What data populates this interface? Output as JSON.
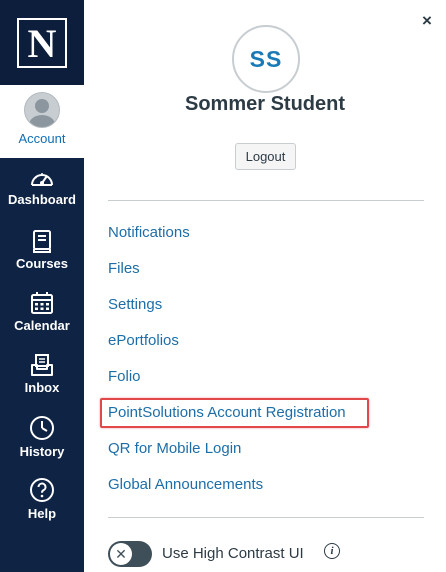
{
  "brand": {
    "logo_letter": "N",
    "nav_bg": "#0f2344",
    "link_color": "#1d6ea8"
  },
  "global_nav": {
    "account_label": "Account",
    "items": [
      {
        "label": "Dashboard",
        "icon": "dashboard-icon"
      },
      {
        "label": "Courses",
        "icon": "courses-icon"
      },
      {
        "label": "Calendar",
        "icon": "calendar-icon"
      },
      {
        "label": "Inbox",
        "icon": "inbox-icon"
      },
      {
        "label": "History",
        "icon": "history-icon"
      },
      {
        "label": "Help",
        "icon": "help-icon"
      }
    ]
  },
  "tray": {
    "close_glyph": "×",
    "avatar_initials": "SS",
    "user_name": "Sommer Student",
    "logout_label": "Logout",
    "links": [
      "Notifications",
      "Files",
      "Settings",
      "ePortfolios",
      "Folio",
      "PointSolutions Account Registration",
      "QR for Mobile Login",
      "Global Announcements"
    ],
    "highlighted_link_index": 5,
    "high_contrast": {
      "label": "Use High Contrast UI",
      "enabled": false,
      "knob_glyph": "✕",
      "info_glyph": "i"
    }
  }
}
